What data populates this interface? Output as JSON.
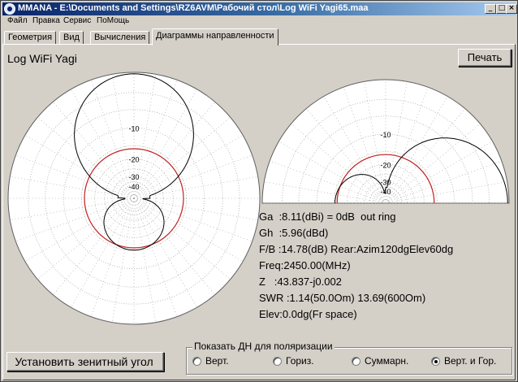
{
  "window": {
    "title": "MMANA - E:\\Documents and Settings\\RZ6AVM\\Рабочий стол\\Log WiFi Yagi65.maa",
    "min_glyph": "_",
    "max_glyph": "□",
    "close_glyph": "×"
  },
  "menu": [
    "Файл",
    "Правка",
    "Сервис",
    "ПоМощь"
  ],
  "tabs": [
    {
      "label": "Геометрия",
      "active": false
    },
    {
      "label": "Вид",
      "active": false
    },
    {
      "label": "Вычисления",
      "active": false
    },
    {
      "label": "Диаграммы направленности",
      "active": true
    }
  ],
  "antenna_name": "Log WiFi Yagi",
  "print_button": "Печать",
  "zenith_button": "Установить зенитный угол",
  "colors": {
    "pattern": "#000000",
    "ref_ring": "#c02020",
    "grid": "#a0a0a0",
    "plot_bg": "#ffffff"
  },
  "chart_data": [
    {
      "type": "polar",
      "name": "azimuth",
      "ring_labels": [
        "-10",
        "-20",
        "-30",
        "-40"
      ],
      "ring_db": [
        -10,
        -20,
        -30,
        -40
      ],
      "db_min": -45,
      "pattern": "main lobe 0dB toward top, rear lobe ~-14.8dB toward bottom",
      "ref_ring_db": -16
    },
    {
      "type": "polar",
      "name": "elevation",
      "ring_labels": [
        "-10",
        "-20",
        "-30",
        "-40"
      ],
      "ring_db": [
        -10,
        -20,
        -30,
        -40
      ],
      "db_min": -45,
      "half": "upper"
    }
  ],
  "readout": {
    "ga": "Ga  :8.11(dBi) = 0dB  out ring",
    "gh": "Gh  :5.96(dBd)",
    "fb": "F/B :14.78(dB) Rear:Azim120dgElev60dg",
    "freq": "Freq:2450.00(MHz)",
    "z": "Z   :43.837-j0.002",
    "swr": "SWR :1.14(50.0Om) 13.69(600Om)",
    "elev": "Elev:0.0dg(Fr space)"
  },
  "polarization": {
    "title": "Показать ДН для поляризации",
    "options": [
      {
        "label": "Верт.",
        "selected": false
      },
      {
        "label": "Гориз.",
        "selected": false
      },
      {
        "label": "Суммарн.",
        "selected": false
      },
      {
        "label": "Верт. и Гор.",
        "selected": true
      }
    ]
  }
}
